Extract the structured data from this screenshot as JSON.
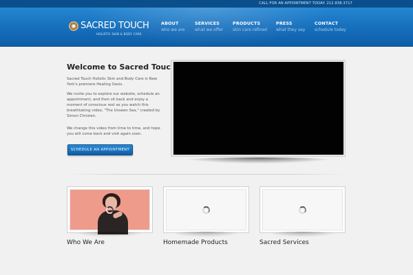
{
  "topbar": {
    "phone_text": "CALL FOR AN APPOINTMENT TODAY: 212.838.3717"
  },
  "logo": {
    "name": "SACRED TOUCH",
    "tagline": "HOLISTIC SKIN & BODY CARE"
  },
  "nav": {
    "items": [
      {
        "label": "ABOUT",
        "sub": "who we are"
      },
      {
        "label": "SERVICES",
        "sub": "what we offer"
      },
      {
        "label": "PRODUCTS",
        "sub": "skin care refined"
      },
      {
        "label": "PRESS",
        "sub": "what they say"
      },
      {
        "label": "CONTACT",
        "sub": "schedule today"
      }
    ]
  },
  "welcome": {
    "title": "Welcome to Sacred Touch",
    "p1": "Sacred Touch Holistic Skin and Body Care is New York's premiere Healing Oasis.",
    "p2": "We invite you to explore our website, schedule an appointment, and then sit back and enjoy a moment of conscious rest as you watch this breathtaking video, \"The Unseen Sea,\" created by Simon Christen.",
    "p3": "We change this video from time to time, and hope you will come back and visit again soon.",
    "cta": "SCHEDULE AN APPOINTMENT"
  },
  "cards": [
    {
      "label": "Who We Are"
    },
    {
      "label": "Homemade Products"
    },
    {
      "label": "Sacred Services"
    }
  ],
  "colors": {
    "header": "#1872bf",
    "topbar": "#0a4f8c",
    "background": "#f1f1f1",
    "photo_bg": "#ef9b8c"
  }
}
